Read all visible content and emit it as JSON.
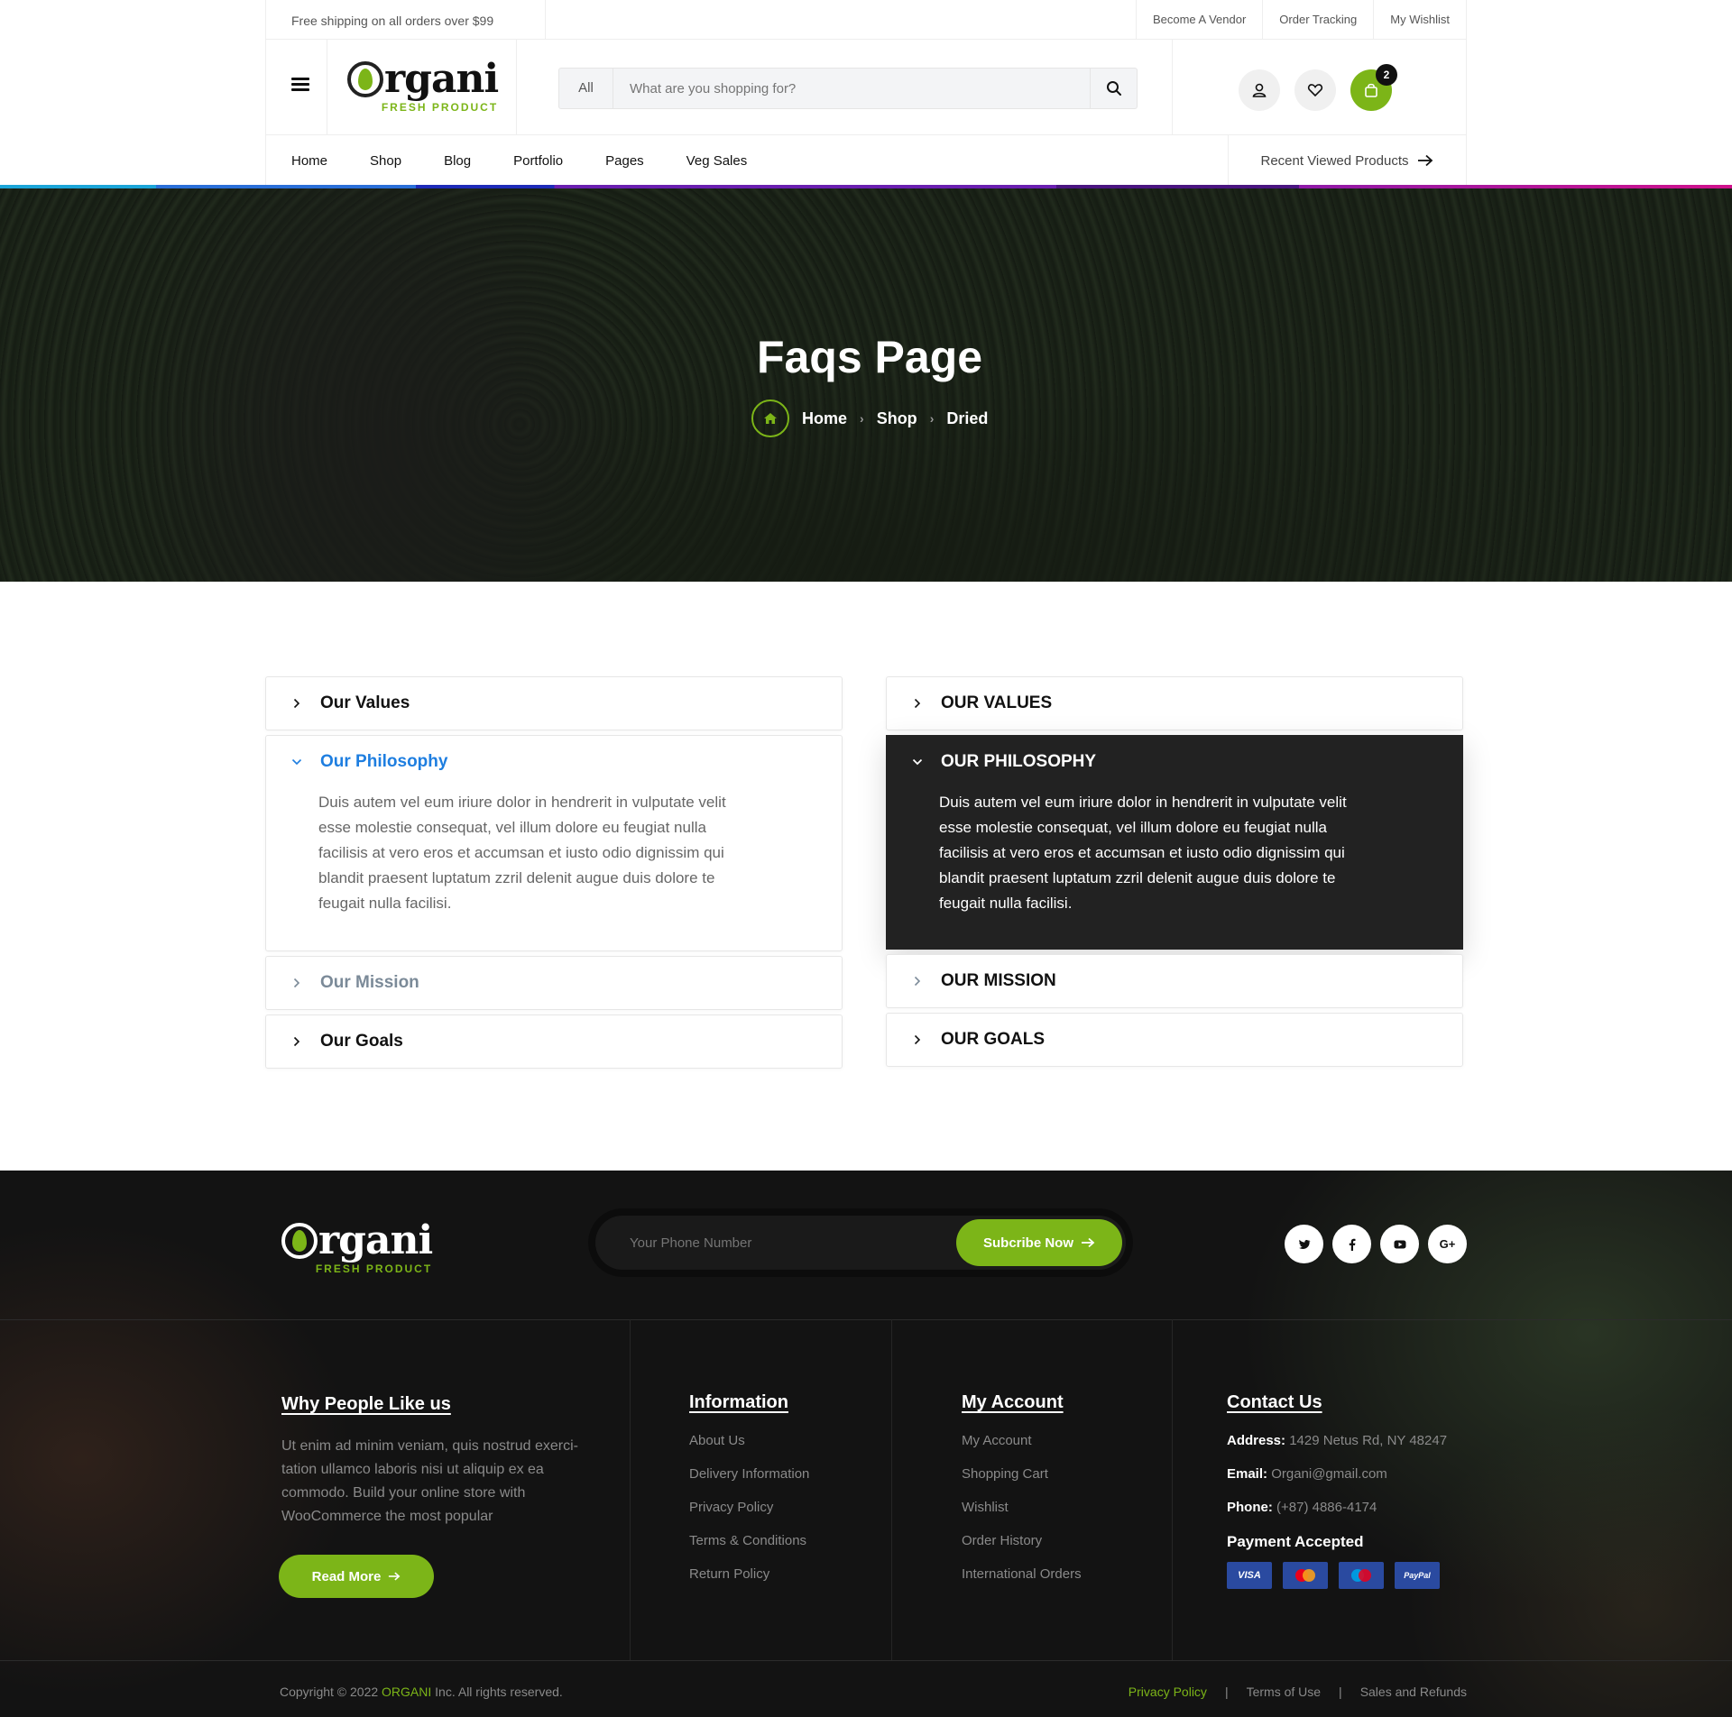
{
  "topbar": {
    "shipping_text": "Free shipping on all orders over $99",
    "links": [
      "Become A Vendor",
      "Order Tracking",
      "My Wishlist"
    ]
  },
  "logo": {
    "text": "rgani",
    "tagline": "FRESH PRODUCT"
  },
  "search": {
    "category": "All",
    "placeholder": "What are you shopping for?"
  },
  "cart": {
    "count": "2"
  },
  "nav": {
    "items": [
      "Home",
      "Shop",
      "Blog",
      "Portfolio",
      "Pages",
      "Veg Sales"
    ],
    "recent_label": "Recent Viewed Products"
  },
  "hero": {
    "title": "Faqs Page",
    "breadcrumb": [
      "Home",
      "Shop",
      "Dried"
    ]
  },
  "faq_left": {
    "items": [
      {
        "title": "Our Values"
      },
      {
        "title": "Our Philosophy",
        "body": "Duis autem vel eum iriure dolor in hendrerit in vulputate velit esse molestie consequat, vel illum dolore eu feugiat nulla facilisis at vero eros et accumsan et iusto odio dignissim qui blandit praesent luptatum zzril delenit augue duis dolore te feugait nulla facilisi."
      },
      {
        "title": "Our Mission"
      },
      {
        "title": "Our Goals"
      }
    ]
  },
  "faq_right": {
    "items": [
      {
        "title": "OUR VALUES"
      },
      {
        "title": "OUR PHILOSOPHY",
        "body": "Duis autem vel eum iriure dolor in hendrerit in vulputate velit esse molestie consequat, vel illum dolore eu feugiat nulla facilisis at vero eros et accumsan et iusto odio dignissim qui blandit praesent luptatum zzril delenit augue duis dolore te feugait nulla facilisi."
      },
      {
        "title": "OUR MISSION"
      },
      {
        "title": "OUR GOALS"
      }
    ]
  },
  "footer": {
    "logo_text": "rgani",
    "logo_tagline": "FRESH PRODUCT",
    "phone_placeholder": "Your Phone Number",
    "subscribe_label": "Subcribe Now",
    "socials": [
      "twitter-icon",
      "facebook-icon",
      "youtube-icon",
      "google-plus-icon"
    ],
    "why": {
      "title": "Why People Like us",
      "text": "Ut enim ad minim veniam, quis nostrud exerci-tation ullamco laboris nisi ut aliquip ex ea commodo. Build your online store with WooCommerce the most popular",
      "button": "Read More"
    },
    "information": {
      "title": "Information",
      "links": [
        "About Us",
        "Delivery Information",
        "Privacy Policy",
        "Terms & Conditions",
        "Return Policy"
      ]
    },
    "account": {
      "title": "My Account",
      "links": [
        "My Account",
        "Shopping Cart",
        "Wishlist",
        "Order History",
        "International Orders"
      ]
    },
    "contact": {
      "title": "Contact Us",
      "address_label": "Address:",
      "address": "1429 Netus Rd, NY 48247",
      "email_label": "Email:",
      "email": "Organi@gmail.com",
      "phone_label": "Phone:",
      "phone": "(+87) 4886-4174",
      "payment_title": "Payment Accepted",
      "cards": [
        "VISA",
        "MasterCard",
        "Maestro",
        "PayPal"
      ]
    },
    "copyright_pre": "Copyright © 2022 ",
    "copyright_brand": "ORGANI",
    "copyright_post": " Inc. All rights reserved.",
    "legal": [
      "Privacy Policy",
      "Terms of Use",
      "Sales and Refunds"
    ]
  },
  "colors": {
    "accent": "#7cb518",
    "link_blue": "#1e7ee0",
    "dark": "#222222"
  }
}
